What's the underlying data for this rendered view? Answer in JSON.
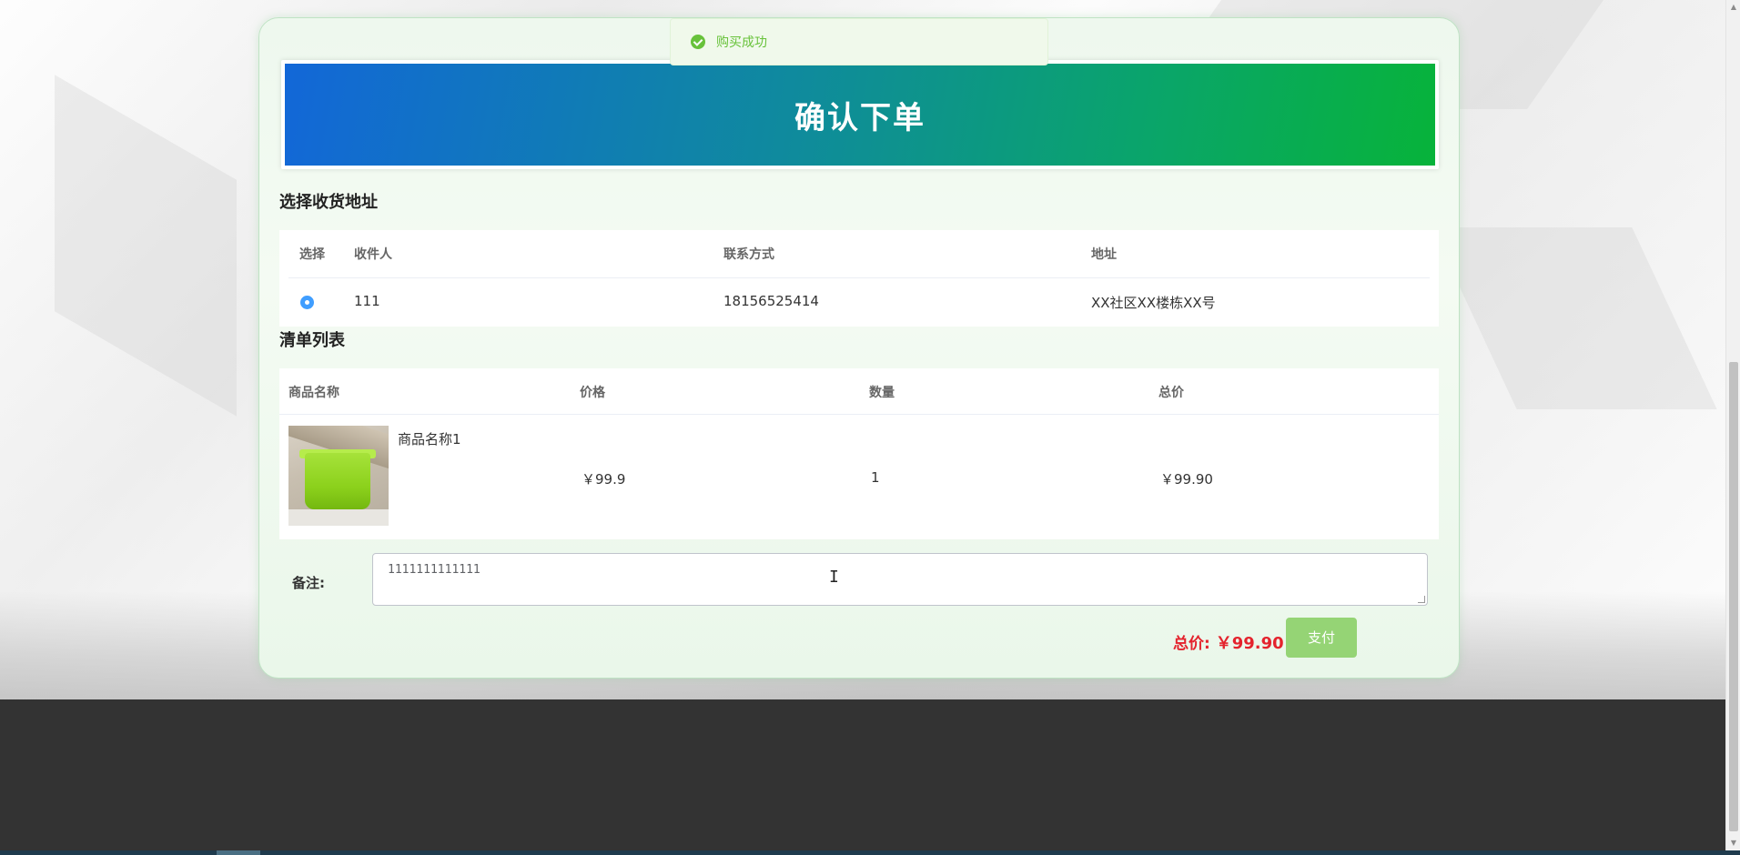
{
  "toast": {
    "message": "购买成功"
  },
  "banner": {
    "title": "确认下单"
  },
  "address_section": {
    "title": "选择收货地址",
    "columns": [
      "选择",
      "收件人",
      "联系方式",
      "地址"
    ],
    "rows": [
      {
        "selected": true,
        "recipient": "111",
        "phone": "18156525414",
        "address": "XX社区XX楼栋XX号"
      }
    ]
  },
  "items_section": {
    "title": "清单列表",
    "columns": [
      "商品名称",
      "价格",
      "数量",
      "总价"
    ],
    "rows": [
      {
        "name": "商品名称1",
        "price": "￥99.9",
        "quantity": "1",
        "subtotal": "￥99.90"
      }
    ]
  },
  "remark": {
    "label": "备注:",
    "value": "1111111111111"
  },
  "summary": {
    "total_label": "总价:",
    "total_value": "￥99.90",
    "pay_label": "支付"
  },
  "colors": {
    "accent_green": "#67c23a",
    "total_red": "#e4232d",
    "pay_button": "#95d475",
    "footer": "#333333"
  }
}
